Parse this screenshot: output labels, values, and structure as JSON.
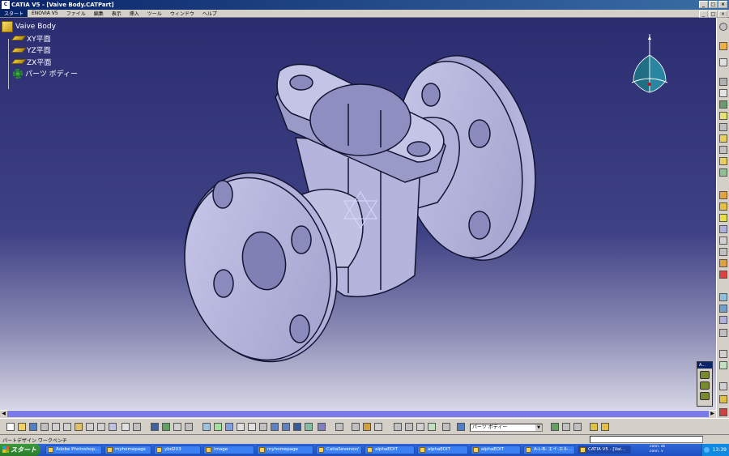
{
  "window": {
    "app_label": "CATIA V5 - [Vaive Body.CATPart]",
    "controls": [
      "_",
      "□",
      "×"
    ]
  },
  "menubar": {
    "items": [
      "スタート",
      "ENOVIA V5",
      "ファイル",
      "編集",
      "表示",
      "挿入",
      "ツール",
      "ウィンドウ",
      "ヘルプ"
    ]
  },
  "tree": {
    "root": "Vaive Body",
    "nodes": [
      "XY平面",
      "YZ平面",
      "ZX平面",
      "パーツ ボディー"
    ]
  },
  "toolbar": {
    "layer_value": "パーツ ボディー"
  },
  "floating_toolbar": {
    "title": "A..."
  },
  "statusbar": {
    "text": "パートデザイン ワークベンチ"
  },
  "taskbar": {
    "start_label": "スタート",
    "items": [
      {
        "label": "Adobe Photoshop...",
        "active": false
      },
      {
        "label": "myhomepage",
        "active": false
      },
      {
        "label": "ybd203",
        "active": false
      },
      {
        "label": "image",
        "active": false
      },
      {
        "label": "myhomepage",
        "active": false
      },
      {
        "label": "CatiaSevenov/",
        "active": false
      },
      {
        "label": "alphaEDIT",
        "active": false
      },
      {
        "label": "alphaEDIT",
        "active": false
      },
      {
        "label": "alphaEDIT",
        "active": false
      },
      {
        "label": "A-L-B- エイ-エル...",
        "active": false
      },
      {
        "label": "CATIA V5 - [Vai...",
        "active": true
      }
    ],
    "connection_1": "conn. ok",
    "connection_2": "conn. ∨",
    "clock": "13:39"
  },
  "colors": {
    "background_top": "#2b2d70",
    "background_bottom": "#d6d6e6",
    "part_face": "#b7b7de",
    "part_edge": "#141432",
    "titlebar": "#0a246a",
    "taskbar": "#1d4fc4"
  }
}
